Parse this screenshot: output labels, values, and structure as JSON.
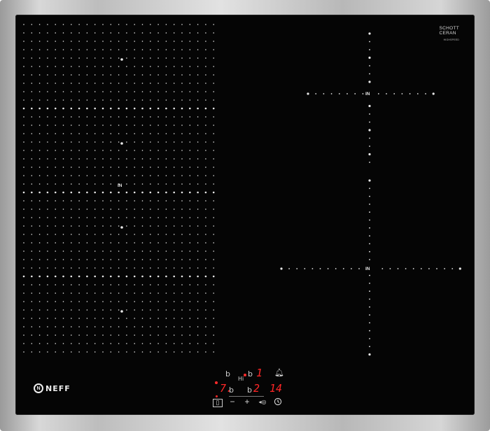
{
  "hob": {
    "brand": "NEFF",
    "glass_brand_line1": "SCHOTT",
    "glass_brand_line2": "CERAN",
    "glass_brand_sub": "HIGHSPEED",
    "induction_marks": [
      "IN",
      "IN",
      "IN"
    ]
  },
  "control_panel": {
    "zone_symbols": [
      "b",
      "b",
      "b",
      "b"
    ],
    "hi_label": "Hi",
    "timer_top_digit": "1",
    "level_left": "7.",
    "level_right": "2",
    "timer_value": "14",
    "icons": {
      "childlock": "childlock-icon",
      "minus": "−",
      "plus": "+",
      "powerboost": "powerboost-icon",
      "clock": "clock-icon",
      "alarm": "alarm-bell-icon"
    }
  },
  "colors": {
    "glass": "#050505",
    "display_red": "#ff2626",
    "marking": "#e8e8e8"
  }
}
